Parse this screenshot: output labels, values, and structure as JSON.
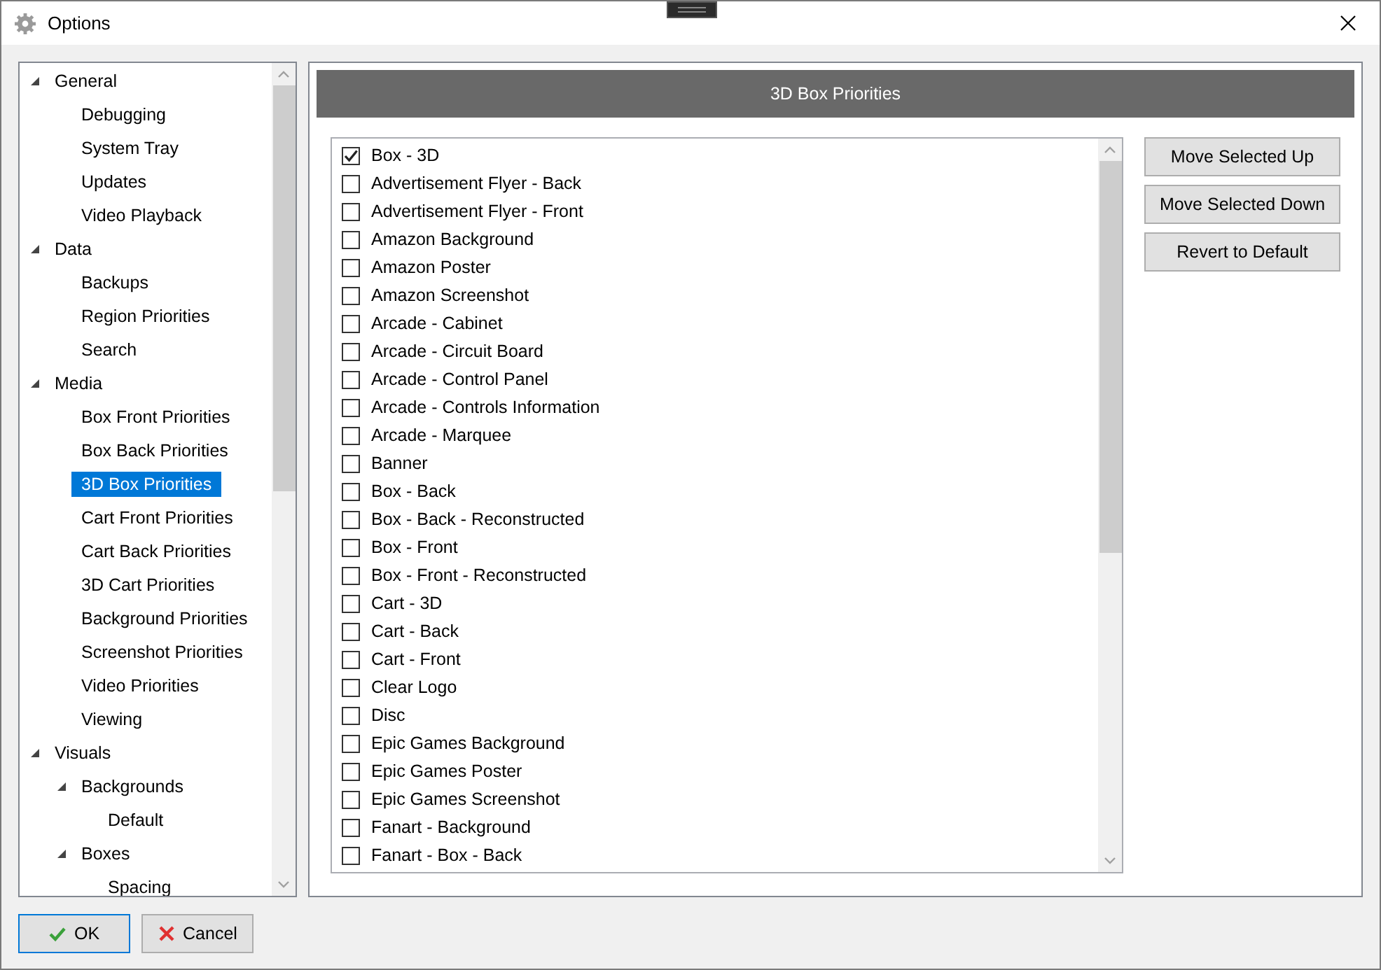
{
  "window": {
    "title": "Options"
  },
  "tree": [
    {
      "label": "General",
      "expanded": true,
      "selected": false,
      "children": [
        {
          "label": "Debugging",
          "selected": false
        },
        {
          "label": "System Tray",
          "selected": false
        },
        {
          "label": "Updates",
          "selected": false
        },
        {
          "label": "Video Playback",
          "selected": false
        }
      ]
    },
    {
      "label": "Data",
      "expanded": true,
      "selected": false,
      "children": [
        {
          "label": "Backups",
          "selected": false
        },
        {
          "label": "Region Priorities",
          "selected": false
        },
        {
          "label": "Search",
          "selected": false
        }
      ]
    },
    {
      "label": "Media",
      "expanded": true,
      "selected": false,
      "children": [
        {
          "label": "Box Front Priorities",
          "selected": false
        },
        {
          "label": "Box Back Priorities",
          "selected": false
        },
        {
          "label": "3D Box Priorities",
          "selected": true
        },
        {
          "label": "Cart Front Priorities",
          "selected": false
        },
        {
          "label": "Cart Back Priorities",
          "selected": false
        },
        {
          "label": "3D Cart Priorities",
          "selected": false
        },
        {
          "label": "Background Priorities",
          "selected": false
        },
        {
          "label": "Screenshot Priorities",
          "selected": false
        },
        {
          "label": "Video Priorities",
          "selected": false
        },
        {
          "label": "Viewing",
          "selected": false
        }
      ]
    },
    {
      "label": "Visuals",
      "expanded": true,
      "selected": false,
      "children": [
        {
          "label": "Backgrounds",
          "expanded": true,
          "selected": false,
          "children": [
            {
              "label": "Default",
              "selected": false
            }
          ]
        },
        {
          "label": "Boxes",
          "expanded": true,
          "selected": false,
          "children": [
            {
              "label": "Spacing",
              "selected": false
            }
          ]
        }
      ]
    }
  ],
  "panel": {
    "title": "3D Box Priorities"
  },
  "items": [
    {
      "label": "Box - 3D",
      "checked": true
    },
    {
      "label": "Advertisement Flyer - Back",
      "checked": false
    },
    {
      "label": "Advertisement Flyer - Front",
      "checked": false
    },
    {
      "label": "Amazon Background",
      "checked": false
    },
    {
      "label": "Amazon Poster",
      "checked": false
    },
    {
      "label": "Amazon Screenshot",
      "checked": false
    },
    {
      "label": "Arcade - Cabinet",
      "checked": false
    },
    {
      "label": "Arcade - Circuit Board",
      "checked": false
    },
    {
      "label": "Arcade - Control Panel",
      "checked": false
    },
    {
      "label": "Arcade - Controls Information",
      "checked": false
    },
    {
      "label": "Arcade - Marquee",
      "checked": false
    },
    {
      "label": "Banner",
      "checked": false
    },
    {
      "label": "Box - Back",
      "checked": false
    },
    {
      "label": "Box - Back - Reconstructed",
      "checked": false
    },
    {
      "label": "Box - Front",
      "checked": false
    },
    {
      "label": "Box - Front - Reconstructed",
      "checked": false
    },
    {
      "label": "Cart - 3D",
      "checked": false
    },
    {
      "label": "Cart - Back",
      "checked": false
    },
    {
      "label": "Cart - Front",
      "checked": false
    },
    {
      "label": "Clear Logo",
      "checked": false
    },
    {
      "label": "Disc",
      "checked": false
    },
    {
      "label": "Epic Games Background",
      "checked": false
    },
    {
      "label": "Epic Games Poster",
      "checked": false
    },
    {
      "label": "Epic Games Screenshot",
      "checked": false
    },
    {
      "label": "Fanart - Background",
      "checked": false
    },
    {
      "label": "Fanart - Box - Back",
      "checked": false
    }
  ],
  "actions": [
    "Move Selected Up",
    "Move Selected Down",
    "Revert to Default"
  ],
  "dialog_buttons": [
    {
      "kind": "ok",
      "label": "OK"
    },
    {
      "kind": "cancel",
      "label": "Cancel"
    }
  ]
}
